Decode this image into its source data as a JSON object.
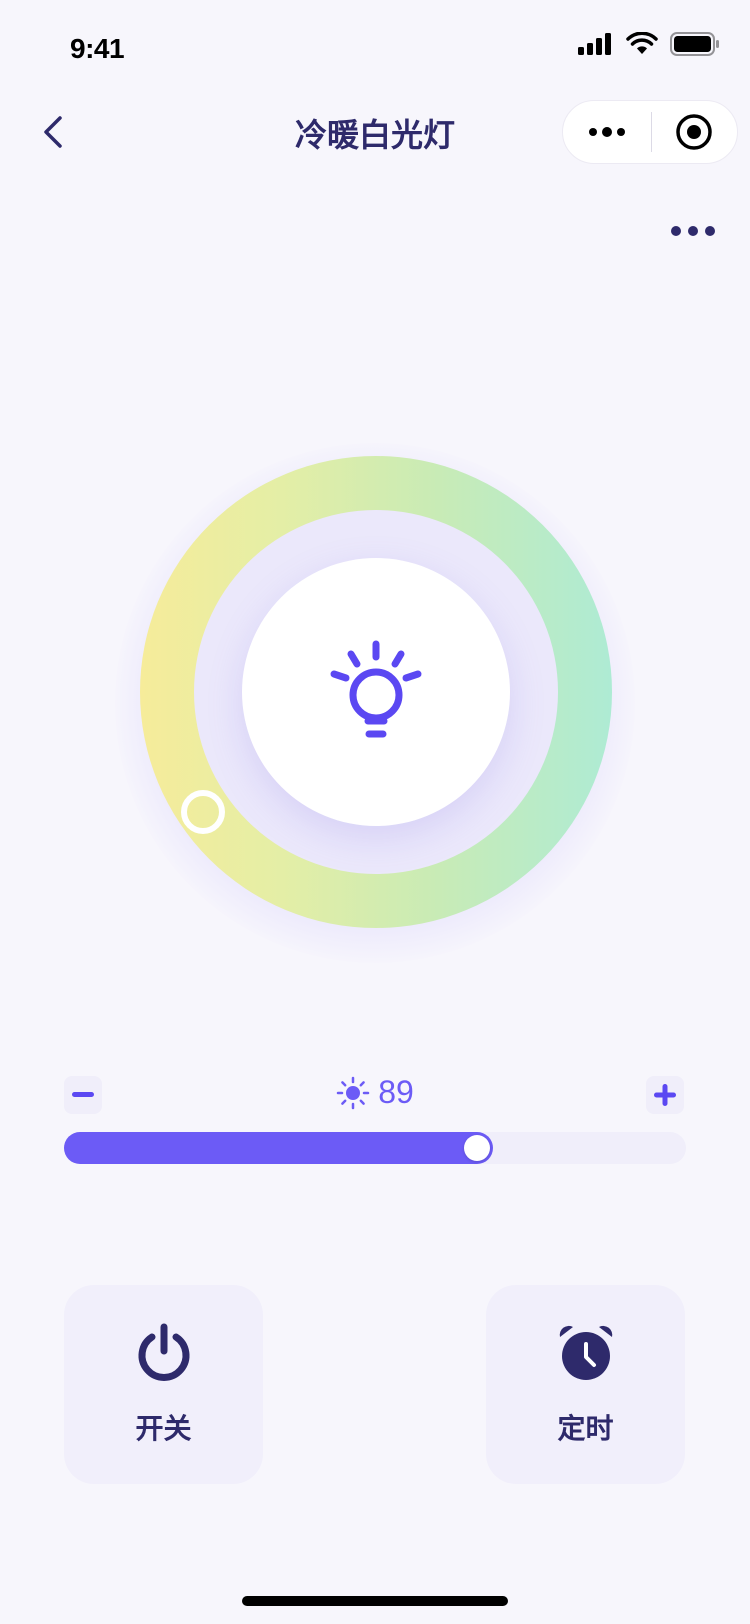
{
  "status_bar": {
    "time": "9:41"
  },
  "nav": {
    "title": "冷暖白光灯"
  },
  "brightness": {
    "value": "89",
    "level": 0.69,
    "min_label": "−",
    "max_label": "+"
  },
  "color_temperature": {
    "position": 0.33
  },
  "actions": {
    "power": {
      "label": "开关"
    },
    "timer": {
      "label": "定时"
    }
  },
  "colors": {
    "accent": "#6C5BF6",
    "title": "#2E2A6B",
    "background": "#F7F6FC",
    "warm": "#F6EC9A",
    "cool": "#AEEBD4"
  },
  "icons": [
    "back-icon",
    "more-dots-icon",
    "capsule-close-icon",
    "light-bulb-icon",
    "sun-icon",
    "minus-icon",
    "plus-icon",
    "power-icon",
    "alarm-clock-icon"
  ]
}
